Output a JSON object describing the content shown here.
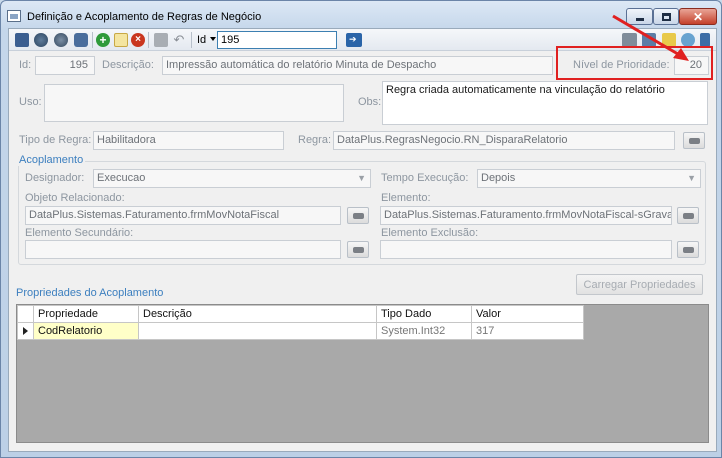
{
  "window": {
    "title": "Definição e Acoplamento de Regras de Negócio"
  },
  "toolbar": {
    "id_label": "Id",
    "id_value": "195"
  },
  "form": {
    "id_label": "Id:",
    "id_value": "195",
    "descricao_label": "Descrição:",
    "descricao_value": "Impressão automática do relatório Minuta de Despacho",
    "prioridade_label": "Nível de Prioridade:",
    "prioridade_value": "20",
    "uso_label": "Uso:",
    "uso_value": "",
    "obs_label": "Obs:",
    "obs_value": "Regra criada automaticamente na vinculação do relatório",
    "tipo_label": "Tipo de Regra:",
    "tipo_value": "Habilitadora",
    "regra_label": "Regra:",
    "regra_value": "DataPlus.RegrasNegocio.RN_DisparaRelatorio"
  },
  "acoplamento": {
    "title": "Acoplamento",
    "designador_label": "Designador:",
    "designador_value": "Execucao",
    "tempo_label": "Tempo Execução:",
    "tempo_value": "Depois",
    "objeto_label": "Objeto Relacionado:",
    "objeto_value": "DataPlus.Sistemas.Faturamento.frmMovNotaFiscal",
    "elemento_label": "Elemento:",
    "elemento_value": "DataPlus.Sistemas.Faturamento.frmMovNotaFiscal-sGravar(",
    "secundario_label": "Elemento Secundário:",
    "secundario_value": "",
    "exclusao_label": "Elemento Exclusão:",
    "exclusao_value": ""
  },
  "propriedades": {
    "title": "Propriedades do Acoplamento",
    "load_button": "Carregar Propriedades",
    "columns": [
      "Propriedade",
      "Descrição",
      "Tipo Dado",
      "Valor"
    ],
    "rows": [
      {
        "propriedade": "CodRelatorio",
        "descricao": "",
        "tipo": "System.Int32",
        "valor": "317"
      }
    ]
  },
  "colors": {
    "accent": "#3c7fbf",
    "highlight": "#e02020"
  }
}
